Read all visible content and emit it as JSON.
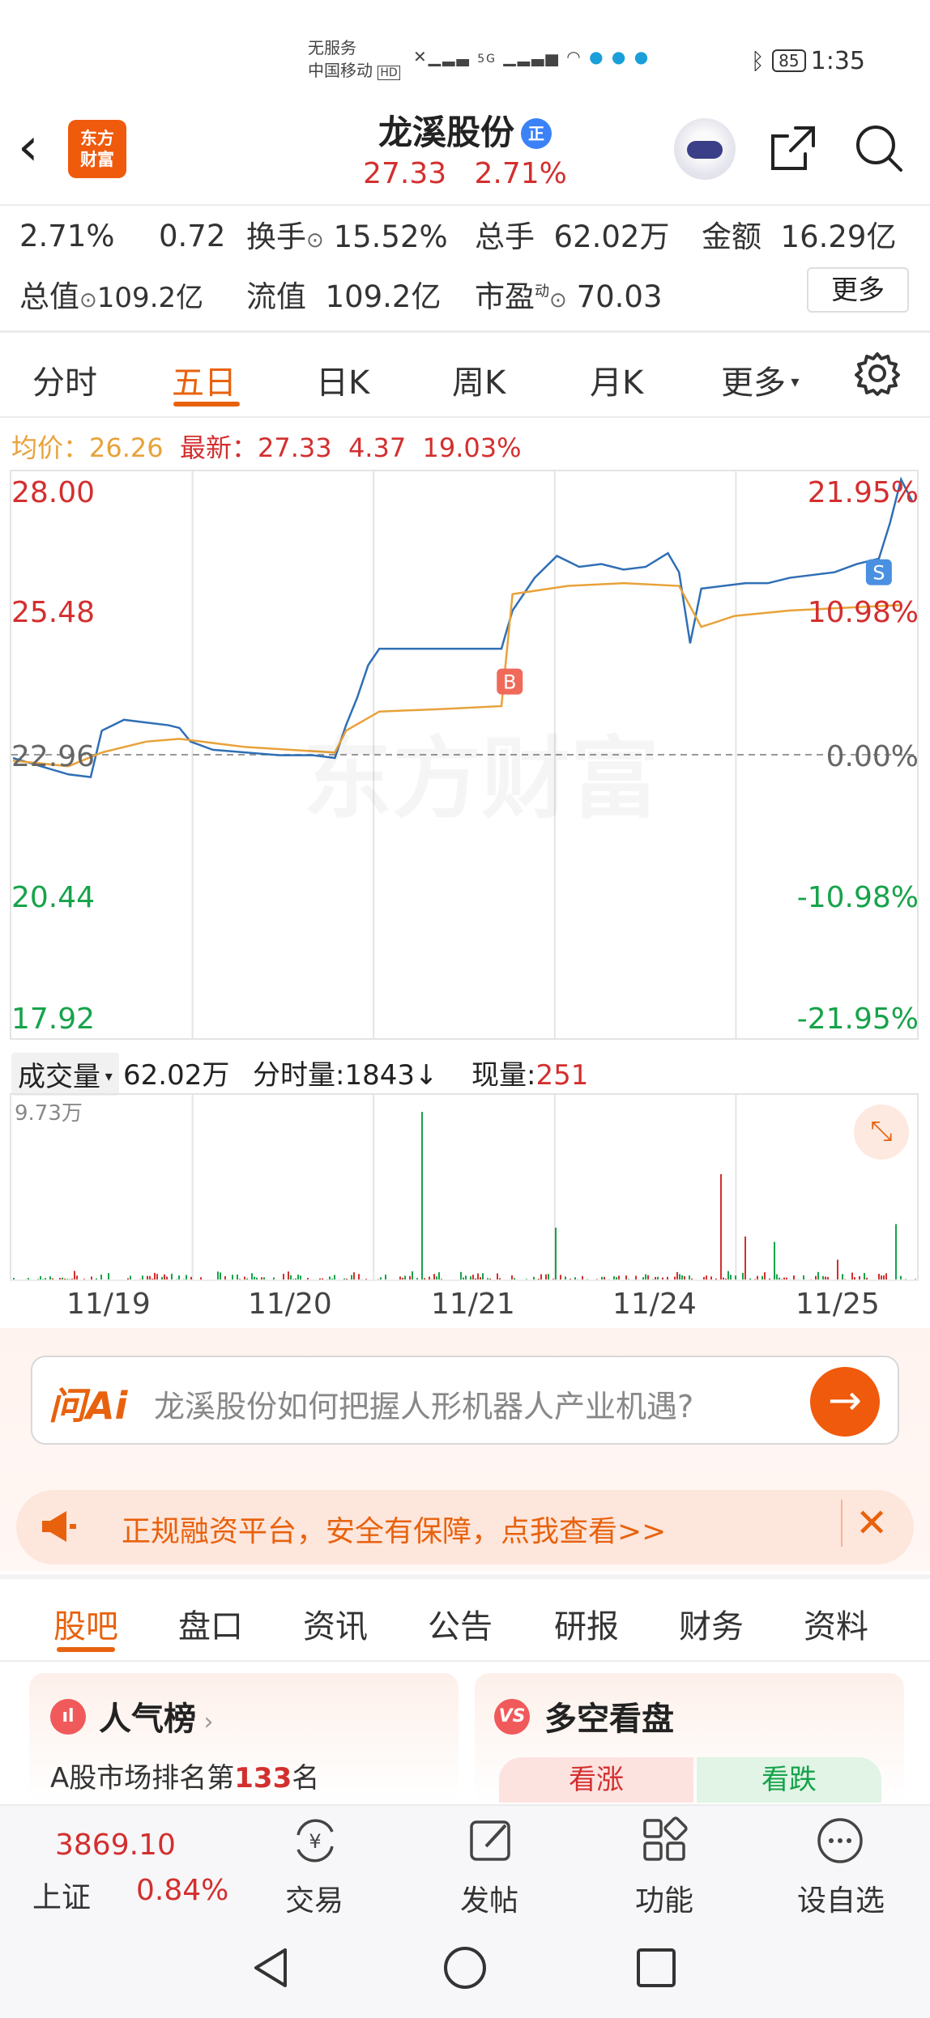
{
  "status_bar": {
    "carrier_line1": "无服务",
    "carrier_line2": "中国移动",
    "hd": "HD",
    "network": "5G",
    "battery": "85",
    "time": "1:35"
  },
  "header": {
    "logo_text": "东方财富",
    "stock_name": "龙溪股份",
    "badge": "正",
    "price": "27.33",
    "change_pct": "2.71%"
  },
  "stats": {
    "pct": "2.71%",
    "chg": "0.72",
    "turnover_label": "换手",
    "turnover": "15.52%",
    "volume_label": "总手",
    "volume": "62.02万",
    "amount_label": "金额",
    "amount": "16.29亿",
    "mktcap_label": "总值",
    "mktcap": "109.2亿",
    "float_label": "流值",
    "float": "109.2亿",
    "pe_label": "市盈",
    "pe_sup": "动",
    "pe": "70.03",
    "more": "更多"
  },
  "chart_tabs": [
    "分时",
    "五日",
    "日K",
    "周K",
    "月K",
    "更多"
  ],
  "active_tab": "五日",
  "info_line": {
    "avg_label": "均价：",
    "avg": "26.26",
    "latest_label": "最新：",
    "latest": "27.33",
    "change": "4.37",
    "pct": "19.03%"
  },
  "watermark": "东方财富",
  "chart_data": {
    "type": "line",
    "x_labels": [
      "11/19",
      "11/20",
      "11/21",
      "11/24",
      "11/25"
    ],
    "y_left_ticks": [
      "28.00",
      "25.48",
      "22.96",
      "20.44",
      "17.92"
    ],
    "y_right_ticks": [
      "21.95%",
      "10.98%",
      "0.00%",
      "-10.98%",
      "-21.95%"
    ],
    "ylim": [
      17.92,
      28.0
    ],
    "base": 22.96,
    "series": [
      {
        "name": "price",
        "color": "#2f6fb5",
        "points": [
          [
            0,
            22.9
          ],
          [
            0.05,
            22.75
          ],
          [
            0.1,
            22.6
          ],
          [
            0.14,
            22.55
          ],
          [
            0.16,
            23.4
          ],
          [
            0.2,
            23.6
          ],
          [
            0.24,
            23.55
          ],
          [
            0.28,
            23.5
          ],
          [
            0.3,
            23.45
          ],
          [
            0.32,
            23.2
          ],
          [
            0.36,
            23.05
          ],
          [
            0.42,
            23.0
          ],
          [
            0.48,
            22.95
          ],
          [
            0.54,
            22.95
          ],
          [
            0.58,
            22.9
          ],
          [
            0.6,
            23.5
          ],
          [
            0.62,
            24.0
          ],
          [
            0.64,
            24.6
          ],
          [
            0.66,
            24.9
          ],
          [
            0.7,
            24.9
          ],
          [
            0.78,
            24.9
          ],
          [
            0.86,
            24.9
          ],
          [
            0.88,
            24.9
          ],
          [
            0.9,
            25.6
          ],
          [
            0.94,
            26.2
          ],
          [
            0.98,
            26.6
          ],
          [
            1.02,
            26.4
          ],
          [
            1.06,
            26.45
          ],
          [
            1.1,
            26.35
          ],
          [
            1.14,
            26.4
          ],
          [
            1.18,
            26.65
          ],
          [
            1.2,
            26.3
          ],
          [
            1.22,
            25.0
          ],
          [
            1.24,
            26.0
          ],
          [
            1.28,
            26.05
          ],
          [
            1.32,
            26.1
          ],
          [
            1.36,
            26.1
          ],
          [
            1.4,
            26.2
          ],
          [
            1.44,
            26.25
          ],
          [
            1.48,
            26.3
          ],
          [
            1.52,
            26.45
          ],
          [
            1.56,
            26.55
          ],
          [
            1.58,
            27.2
          ],
          [
            1.6,
            28.0
          ],
          [
            1.62,
            27.6
          ]
        ]
      },
      {
        "name": "avg",
        "color": "#e8a23a",
        "points": [
          [
            0,
            22.85
          ],
          [
            0.1,
            22.75
          ],
          [
            0.16,
            23.0
          ],
          [
            0.24,
            23.2
          ],
          [
            0.3,
            23.25
          ],
          [
            0.42,
            23.1
          ],
          [
            0.58,
            23.0
          ],
          [
            0.6,
            23.4
          ],
          [
            0.66,
            23.75
          ],
          [
            0.78,
            23.8
          ],
          [
            0.88,
            23.85
          ],
          [
            0.9,
            25.9
          ],
          [
            1.0,
            26.05
          ],
          [
            1.1,
            26.1
          ],
          [
            1.2,
            26.05
          ],
          [
            1.24,
            25.3
          ],
          [
            1.3,
            25.5
          ],
          [
            1.4,
            25.6
          ],
          [
            1.5,
            25.65
          ],
          [
            1.6,
            25.7
          ]
        ]
      }
    ],
    "markers": [
      {
        "label": "B",
        "color": "#f06a5a",
        "x": 0.895,
        "y": 24.3
      },
      {
        "label": "S",
        "color": "#4a90e2",
        "x": 1.56,
        "y": 26.3
      }
    ],
    "grid": true,
    "day_dividers": 4
  },
  "volume": {
    "label": "成交量",
    "total": "62.02万",
    "time_vol_label": "分时量:",
    "time_vol": "1843",
    "arrow": "↓",
    "now_label": "现量:",
    "now": "251",
    "max": "9.73万"
  },
  "ai": {
    "logo": "问Ai",
    "prompt": "龙溪股份如何把握人形机器人产业机遇?",
    "arrow": "→"
  },
  "banner": {
    "text": "正规融资平台，安全有保障，点我查看>>",
    "close": "✕"
  },
  "sections": [
    "股吧",
    "盘口",
    "资讯",
    "公告",
    "研报",
    "财务",
    "资料"
  ],
  "cards": {
    "popularity_title": "人气榜",
    "popularity_text_a": "A股市场排名第",
    "popularity_rank": "133",
    "popularity_text_b": "名",
    "bullbear_title": "多空看盘",
    "bull": "看涨",
    "bear": "看跌"
  },
  "bottom_nav": {
    "index_value": "3869.10",
    "index_name": "上证",
    "index_pct": "0.84%",
    "items": [
      "交易",
      "发帖",
      "功能",
      "设自选"
    ]
  }
}
